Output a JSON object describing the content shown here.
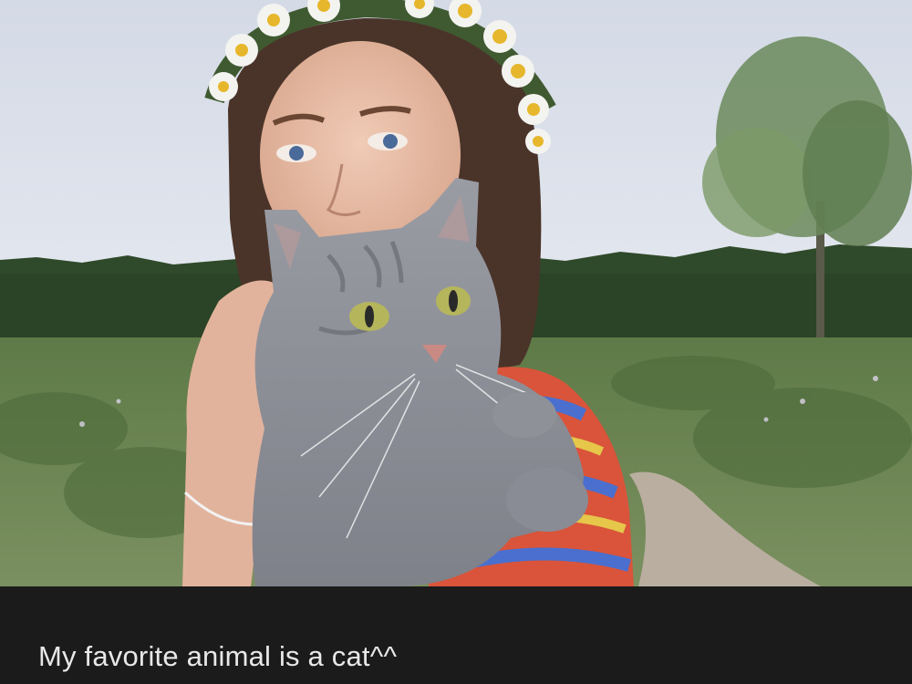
{
  "caption": {
    "text": "My favorite animal is a cat^^"
  },
  "photo": {
    "subject": "photo",
    "colors": {
      "sky": "#d9dee8",
      "forest": "#2f4a2a",
      "meadow": "#6f8a55",
      "path": "#b9aea0",
      "cat_fur": "#8a8c95",
      "cat_eyes": "#b5b55c",
      "hair": "#4a3429",
      "skin": "#e9c2ad",
      "daisy_petal": "#f3f3f0",
      "daisy_center": "#e6b72c"
    }
  },
  "colors": {
    "caption_bar": "#1b1b1b",
    "caption_text": "#e8e8e8"
  }
}
